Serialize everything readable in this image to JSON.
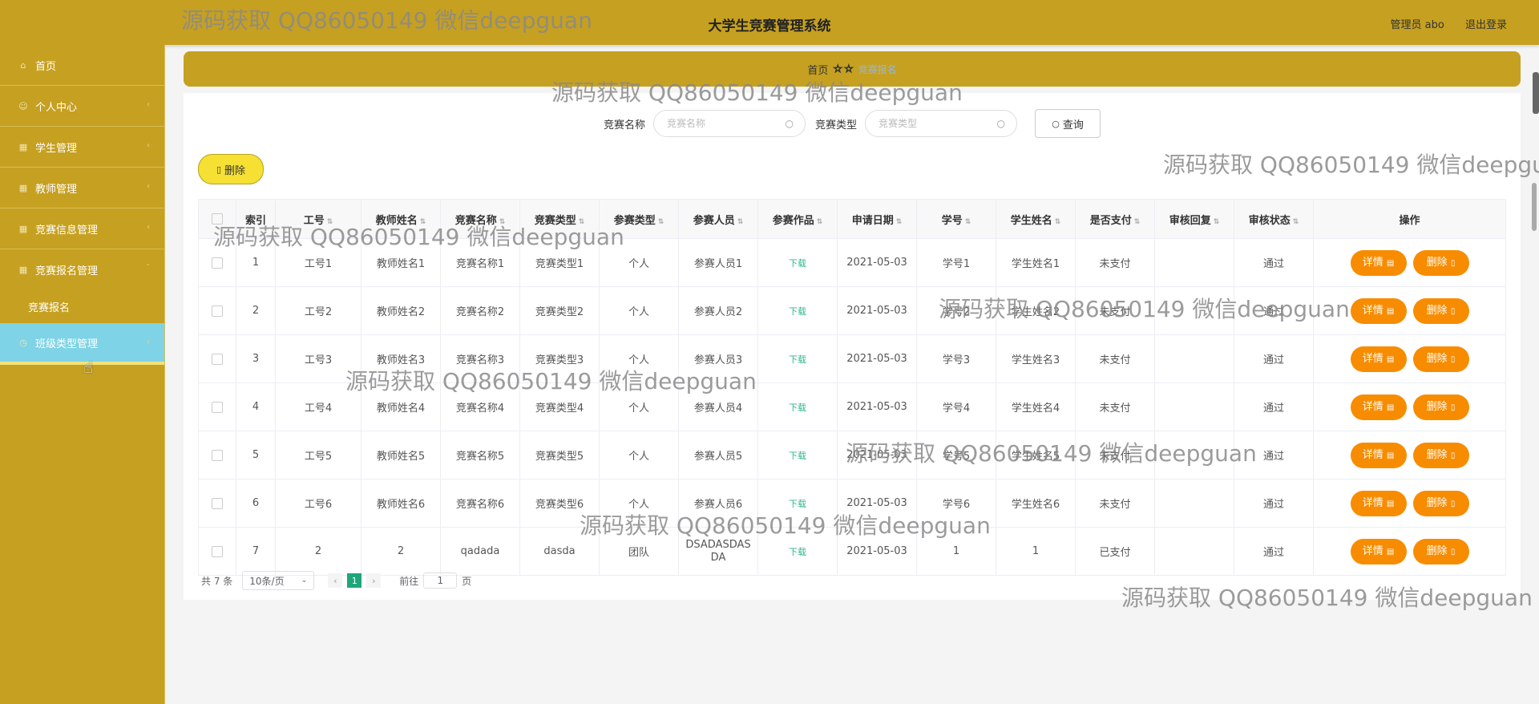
{
  "header": {
    "title": "大学生竞赛管理系统",
    "user": "管理员 abo",
    "logout": "退出登录"
  },
  "sidebar": {
    "items": [
      {
        "label": "首页",
        "icon": "home-icon"
      },
      {
        "label": "个人中心",
        "icon": "user-icon"
      },
      {
        "label": "学生管理",
        "icon": "grid-icon"
      },
      {
        "label": "教师管理",
        "icon": "grid-icon"
      },
      {
        "label": "竞赛信息管理",
        "icon": "grid-icon"
      },
      {
        "label": "竞赛报名管理",
        "icon": "grid-icon"
      }
    ],
    "sub_item": "竞赛报名",
    "active_item": "班级类型管理"
  },
  "breadcrumb": {
    "home": "首页",
    "current": "竞赛报名"
  },
  "search": {
    "name_label": "竞赛名称",
    "name_placeholder": "竞赛名称",
    "type_label": "竞赛类型",
    "type_placeholder": "竞赛类型",
    "query_label": "查询"
  },
  "delete_label": "删除",
  "table": {
    "headers": [
      "索引",
      "工号",
      "教师姓名",
      "竞赛名称",
      "竞赛类型",
      "参赛类型",
      "参赛人员",
      "参赛作品",
      "申请日期",
      "学号",
      "学生姓名",
      "是否支付",
      "审核回复",
      "审核状态",
      "操作"
    ],
    "detail_label": "详情",
    "delete_label": "删除",
    "rows": [
      {
        "idx": "1",
        "gh": "工号1",
        "js": "教师姓名1",
        "mc": "竞赛名称1",
        "lx": "竞赛类型1",
        "cs": "个人",
        "ry": "参赛人员1",
        "zp": "下载",
        "rq": "2021-05-03",
        "xh": "学号1",
        "xs": "学生姓名1",
        "zf": "未支付",
        "hf": "",
        "zt": "通过"
      },
      {
        "idx": "2",
        "gh": "工号2",
        "js": "教师姓名2",
        "mc": "竞赛名称2",
        "lx": "竞赛类型2",
        "cs": "个人",
        "ry": "参赛人员2",
        "zp": "下载",
        "rq": "2021-05-03",
        "xh": "学号2",
        "xs": "学生姓名2",
        "zf": "未支付",
        "hf": "",
        "zt": "通过"
      },
      {
        "idx": "3",
        "gh": "工号3",
        "js": "教师姓名3",
        "mc": "竞赛名称3",
        "lx": "竞赛类型3",
        "cs": "个人",
        "ry": "参赛人员3",
        "zp": "下载",
        "rq": "2021-05-03",
        "xh": "学号3",
        "xs": "学生姓名3",
        "zf": "未支付",
        "hf": "",
        "zt": "通过"
      },
      {
        "idx": "4",
        "gh": "工号4",
        "js": "教师姓名4",
        "mc": "竞赛名称4",
        "lx": "竞赛类型4",
        "cs": "个人",
        "ry": "参赛人员4",
        "zp": "下载",
        "rq": "2021-05-03",
        "xh": "学号4",
        "xs": "学生姓名4",
        "zf": "未支付",
        "hf": "",
        "zt": "通过"
      },
      {
        "idx": "5",
        "gh": "工号5",
        "js": "教师姓名5",
        "mc": "竞赛名称5",
        "lx": "竞赛类型5",
        "cs": "个人",
        "ry": "参赛人员5",
        "zp": "下载",
        "rq": "2021-05-03",
        "xh": "学号5",
        "xs": "学生姓名5",
        "zf": "未支付",
        "hf": "",
        "zt": "通过"
      },
      {
        "idx": "6",
        "gh": "工号6",
        "js": "教师姓名6",
        "mc": "竞赛名称6",
        "lx": "竞赛类型6",
        "cs": "个人",
        "ry": "参赛人员6",
        "zp": "下载",
        "rq": "2021-05-03",
        "xh": "学号6",
        "xs": "学生姓名6",
        "zf": "未支付",
        "hf": "",
        "zt": "通过"
      },
      {
        "idx": "7",
        "gh": "2",
        "js": "2",
        "mc": "qadada",
        "lx": "dasda",
        "cs": "团队",
        "ry": "DSADASDASDA",
        "zp": "下载",
        "rq": "2021-05-03",
        "xh": "1",
        "xs": "1",
        "zf": "已支付",
        "hf": "",
        "zt": "通过"
      }
    ]
  },
  "pager": {
    "total": "共 7 条",
    "size": "10条/页",
    "current": "1",
    "goto_label": "前往",
    "goto_value": "1",
    "page_unit": "页"
  },
  "watermark": "源码获取 QQ86050149 微信deepguan",
  "colors": {
    "theme": "#c6a020",
    "active": "#7fd3e6",
    "action": "#f78c00",
    "link": "#31b58a",
    "delete_btn": "#f5e033"
  }
}
